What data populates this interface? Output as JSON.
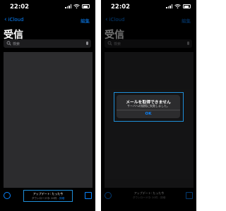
{
  "left_screen": {
    "status_time": "22:02",
    "back_label": "iCloud",
    "edit_label": "編集",
    "title": "受信",
    "search_placeholder": "検索",
    "toolbar_line1": "アップデート: たった今",
    "toolbar_line2_prefix": "ダウンロード中: 20件 -",
    "toolbar_line2_link": "詳細"
  },
  "right_screen": {
    "status_time": "22:02",
    "back_label": "iCloud",
    "edit_label": "編集",
    "title": "受信",
    "search_placeholder": "検索",
    "toolbar_line1": "アップデート: たった今",
    "toolbar_line2": "ダウンロード中: 20件 - 詳細",
    "alert_title": "メールを取得できません",
    "alert_message": "サーバへの接続に失敗しました。",
    "alert_ok": "OK"
  },
  "colors": {
    "accent": "#0a84ff",
    "highlight": "#1f8fd9",
    "background": "#000000",
    "panel": "#2c2c2e"
  },
  "icons": [
    "back-chevron-icon",
    "search-icon",
    "mic-icon",
    "filter-icon",
    "compose-icon",
    "wifi-icon",
    "battery-icon",
    "signal-icon"
  ]
}
